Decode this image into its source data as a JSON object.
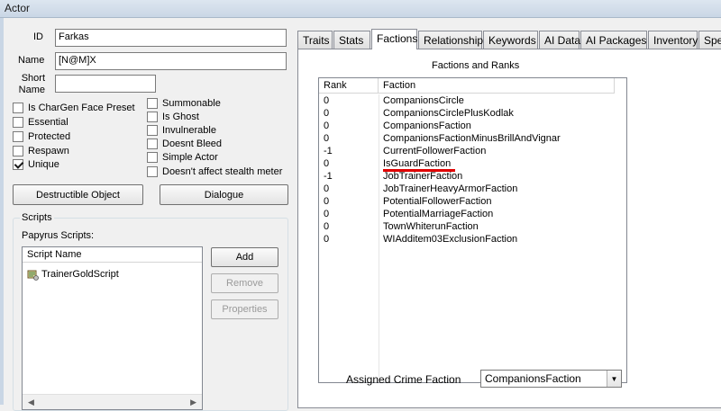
{
  "window": {
    "title": "Actor"
  },
  "fields": {
    "id_label": "ID",
    "id_value": "Farkas",
    "name_label": "Name",
    "name_value": "[N@M]X",
    "short_name_label_1": "Short",
    "short_name_label_2": "Name",
    "short_name_value": ""
  },
  "checkboxes_left": [
    {
      "label": "Is CharGen Face Preset",
      "checked": false
    },
    {
      "label": "Essential",
      "checked": false
    },
    {
      "label": "Protected",
      "checked": false
    },
    {
      "label": "Respawn",
      "checked": false
    },
    {
      "label": "Unique",
      "checked": true
    }
  ],
  "checkboxes_right": [
    {
      "label": "Summonable",
      "checked": false
    },
    {
      "label": "Is Ghost",
      "checked": false
    },
    {
      "label": "Invulnerable",
      "checked": false
    },
    {
      "label": "Doesnt Bleed",
      "checked": false
    },
    {
      "label": "Simple Actor",
      "checked": false
    },
    {
      "label": "Doesn't affect stealth meter",
      "checked": false
    }
  ],
  "buttons": {
    "destructible": "Destructible Object",
    "dialogue": "Dialogue",
    "add": "Add",
    "remove": "Remove",
    "properties": "Properties"
  },
  "scripts": {
    "group_title": "Scripts",
    "papyrus_label": "Papyrus Scripts:",
    "column": "Script Name",
    "items": [
      "TrainerGoldScript"
    ]
  },
  "tabs": [
    {
      "label": "Traits",
      "active": false
    },
    {
      "label": "Stats",
      "active": false
    },
    {
      "label": "Factions",
      "active": true
    },
    {
      "label": "Relationships",
      "active": false
    },
    {
      "label": "Keywords",
      "active": false
    },
    {
      "label": "AI Data",
      "active": false
    },
    {
      "label": "AI Packages",
      "active": false
    },
    {
      "label": "Inventory",
      "active": false
    },
    {
      "label": "Spe",
      "active": false
    }
  ],
  "factions": {
    "title": "Factions and Ranks",
    "col_rank": "Rank",
    "col_faction": "Faction",
    "rows": [
      {
        "rank": "0",
        "faction": "CompanionsCircle"
      },
      {
        "rank": "0",
        "faction": "CompanionsCirclePlusKodlak"
      },
      {
        "rank": "0",
        "faction": "CompanionsFaction"
      },
      {
        "rank": "0",
        "faction": "CompanionsFactionMinusBrillAndVignar"
      },
      {
        "rank": "-1",
        "faction": "CurrentFollowerFaction"
      },
      {
        "rank": "0",
        "faction": "IsGuardFaction"
      },
      {
        "rank": "-1",
        "faction": "JobTrainerFaction"
      },
      {
        "rank": "0",
        "faction": "JobTrainerHeavyArmorFaction"
      },
      {
        "rank": "0",
        "faction": "PotentialFollowerFaction"
      },
      {
        "rank": "0",
        "faction": "PotentialMarriageFaction"
      },
      {
        "rank": "0",
        "faction": "TownWhiterunFaction"
      },
      {
        "rank": "0",
        "faction": "WIAdditem03ExclusionFaction"
      }
    ],
    "highlight_color": "#e00000"
  },
  "crime": {
    "label": "Assigned Crime Faction",
    "value": "CompanionsFaction"
  }
}
